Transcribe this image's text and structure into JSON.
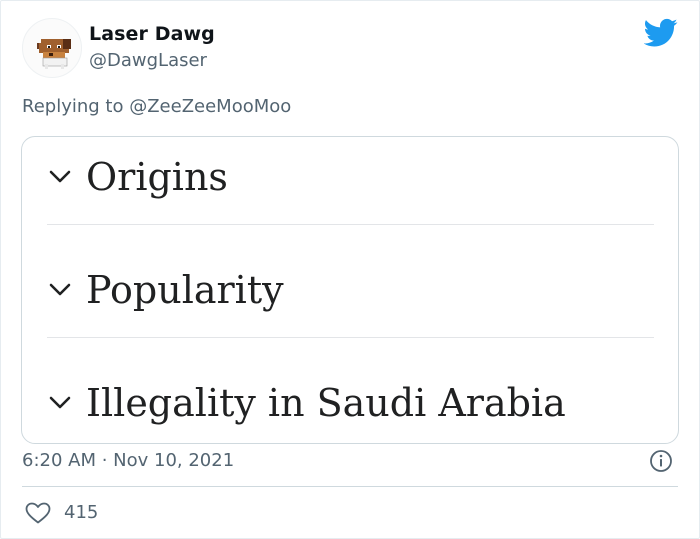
{
  "author": {
    "display_name": "Laser Dawg",
    "handle": "@DawgLaser"
  },
  "reply_context": {
    "prefix": "Replying to",
    "mention": "@ZeeZeeMooMoo"
  },
  "accordion": {
    "items": [
      {
        "label": "Origins"
      },
      {
        "label": "Popularity"
      },
      {
        "label": "Illegality in Saudi Arabia"
      }
    ]
  },
  "meta": {
    "timestamp": "6:20 AM · Nov 10, 2021"
  },
  "engagement": {
    "likes": "415"
  },
  "icons": {
    "brand": "twitter-bird-icon",
    "info": "info-icon",
    "like": "heart-icon",
    "expand": "chevron-down-icon"
  },
  "colors": {
    "twitter_blue": "#1d9bf0",
    "muted_text": "#536471",
    "border": "#cfd9de"
  }
}
